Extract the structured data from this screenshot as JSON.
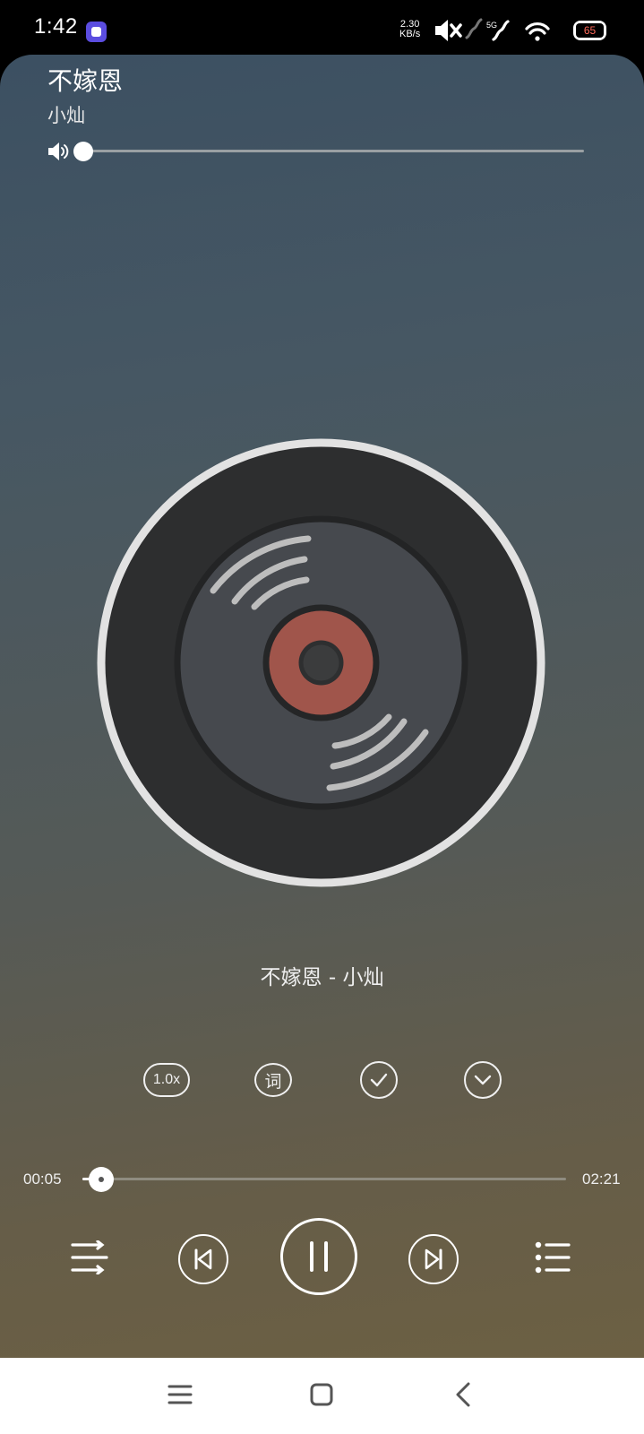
{
  "status_bar": {
    "time": "1:42",
    "net_speed_value": "2.30",
    "net_speed_unit": "KB/s",
    "network": "5G",
    "battery": "65",
    "icons": [
      "app-notification-icon",
      "mute-icon",
      "signal-icon",
      "signal-5g-icon",
      "wifi-icon",
      "battery-icon"
    ]
  },
  "song": {
    "title": "不嫁恩",
    "artist": "小灿",
    "now_playing": "不嫁恩 - 小灿"
  },
  "volume": {
    "level": 0.0,
    "icon": "speaker-icon"
  },
  "tools": {
    "speed_label": "1.0x",
    "lyrics_label": "词",
    "check_icon": "check-circle-icon",
    "collapse_icon": "chevron-down-icon"
  },
  "progress": {
    "current": "00:05",
    "total": "02:21",
    "fraction": 0.035
  },
  "controls": {
    "icons": [
      "play-mode-icon",
      "previous-icon",
      "pause-icon",
      "next-icon",
      "playlist-icon"
    ]
  },
  "nav": {
    "icons": [
      "menu-icon",
      "home-icon",
      "back-icon"
    ]
  },
  "colors": {
    "disc_label": "#a0554b",
    "disc_rim": "#e0e0e0",
    "app_icon": "#5b4de0",
    "battery_text": "#ff6a5a"
  }
}
